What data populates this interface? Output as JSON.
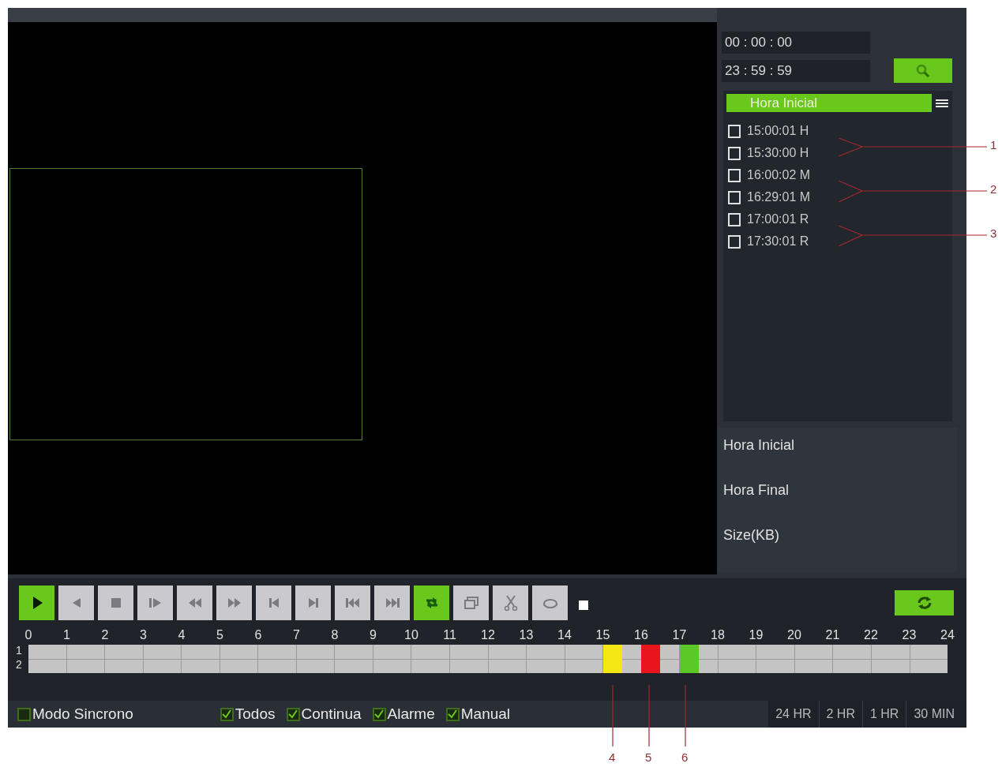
{
  "search": {
    "start_time": "00 : 00 : 00",
    "end_time": "23 : 59 : 59"
  },
  "file_list": {
    "header": "Hora Inicial",
    "rows": [
      {
        "time": "15:00:01",
        "type": "H",
        "checked": false
      },
      {
        "time": "15:30:00",
        "type": "H",
        "checked": false
      },
      {
        "time": "16:00:02",
        "type": "M",
        "checked": false
      },
      {
        "time": "16:29:01",
        "type": "M",
        "checked": false
      },
      {
        "time": "17:00:01",
        "type": "R",
        "checked": false
      },
      {
        "time": "17:30:01",
        "type": "R",
        "checked": false
      }
    ]
  },
  "file_info": [
    "Hora Inicial",
    "Hora Final",
    "Size(KB)"
  ],
  "controls": [
    {
      "kind": "play",
      "on": true
    },
    {
      "kind": "reverse",
      "on": false
    },
    {
      "kind": "stop",
      "on": false
    },
    {
      "kind": "step",
      "on": false
    },
    {
      "kind": "slow",
      "on": false
    },
    {
      "kind": "fast",
      "on": false
    },
    {
      "kind": "prevframe",
      "on": false
    },
    {
      "kind": "nextframe",
      "on": false
    },
    {
      "kind": "prevfile",
      "on": false
    },
    {
      "kind": "nextfile",
      "on": false
    },
    {
      "kind": "loop",
      "on": true
    },
    {
      "kind": "window",
      "on": false
    },
    {
      "kind": "clip",
      "on": false
    },
    {
      "kind": "backup",
      "on": false
    }
  ],
  "timeline": {
    "hours": [
      "0",
      "1",
      "2",
      "3",
      "4",
      "5",
      "6",
      "7",
      "8",
      "9",
      "10",
      "11",
      "12",
      "13",
      "14",
      "15",
      "16",
      "17",
      "18",
      "19",
      "20",
      "21",
      "22",
      "23",
      "24"
    ],
    "channels": [
      "1",
      "2"
    ],
    "segments": [
      {
        "color": "#f5e614"
      },
      {
        "color": "#e8141e"
      },
      {
        "color": "#5cc828"
      }
    ]
  },
  "filters": [
    {
      "label": "Modo Sincrono",
      "checked": false
    },
    {
      "label": "Todos",
      "checked": true
    },
    {
      "label": "Continua",
      "checked": true
    },
    {
      "label": "Alarme",
      "checked": true
    },
    {
      "label": "Manual",
      "checked": true
    }
  ],
  "zoom_tabs": [
    {
      "label": "24 HR",
      "selected": false
    },
    {
      "label": "2 HR",
      "selected": false
    },
    {
      "label": "1 HR",
      "selected": false
    },
    {
      "label": "30 MIN",
      "selected": false
    }
  ],
  "callouts": [
    {
      "label": "1"
    },
    {
      "label": "2"
    },
    {
      "label": "3"
    },
    {
      "label": "4"
    },
    {
      "label": "5"
    },
    {
      "label": "6"
    }
  ]
}
